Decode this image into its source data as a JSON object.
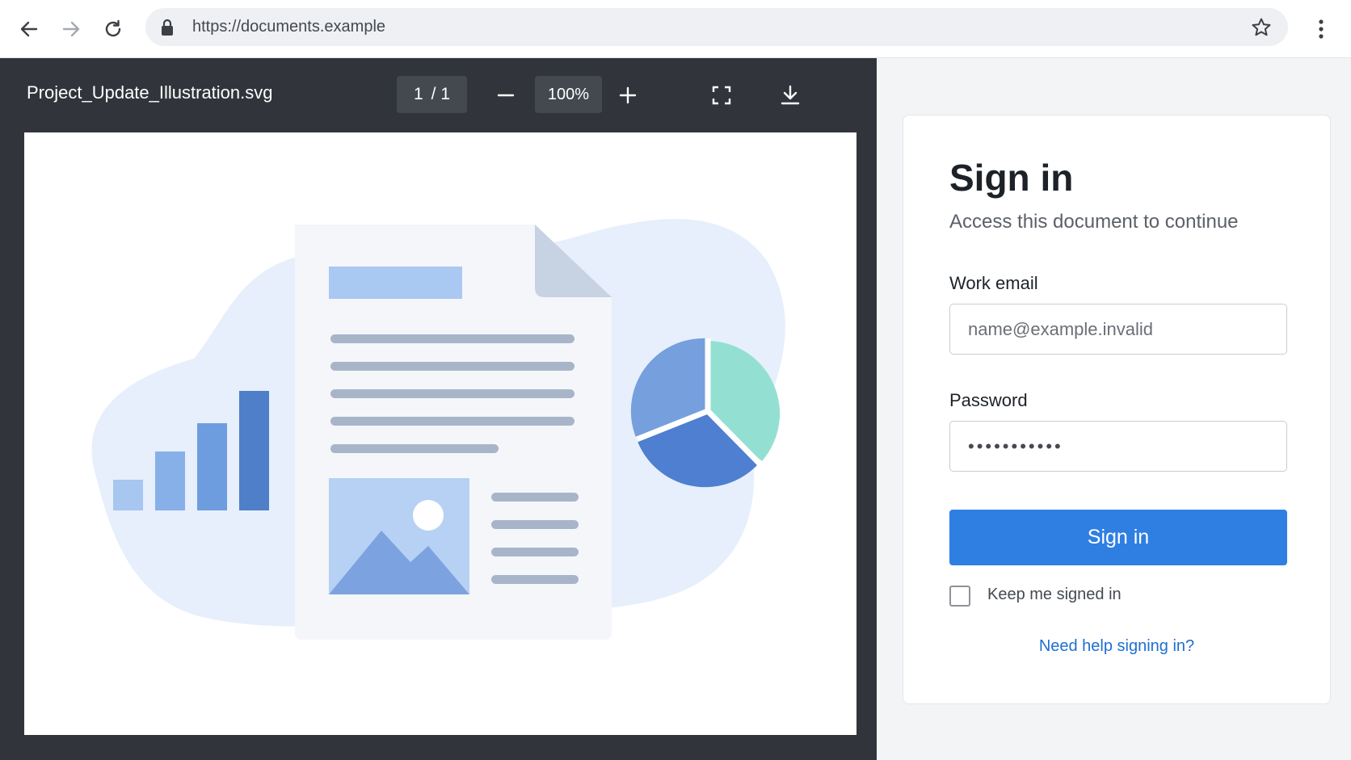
{
  "browser": {
    "url": "https://documents.example"
  },
  "viewer": {
    "filename": "Project_Update_Illustration.svg",
    "page_current": "1",
    "page_total": "/ 1",
    "zoom": "100%"
  },
  "signin": {
    "title": "Sign in",
    "subtitle": "Access this document to continue",
    "email_label": "Work email",
    "email_placeholder": "name@example.invalid",
    "password_label": "Password",
    "password_value": "•••••••••••",
    "submit_label": "Sign in",
    "keep_signed_in_label": "Keep me signed in",
    "keep_signed_in_checked": false,
    "help_link": "Need help signing in?"
  },
  "colors": {
    "accent": "#2f7fe3",
    "link": "#1f6fd1",
    "viewer_bg": "#31353b"
  }
}
